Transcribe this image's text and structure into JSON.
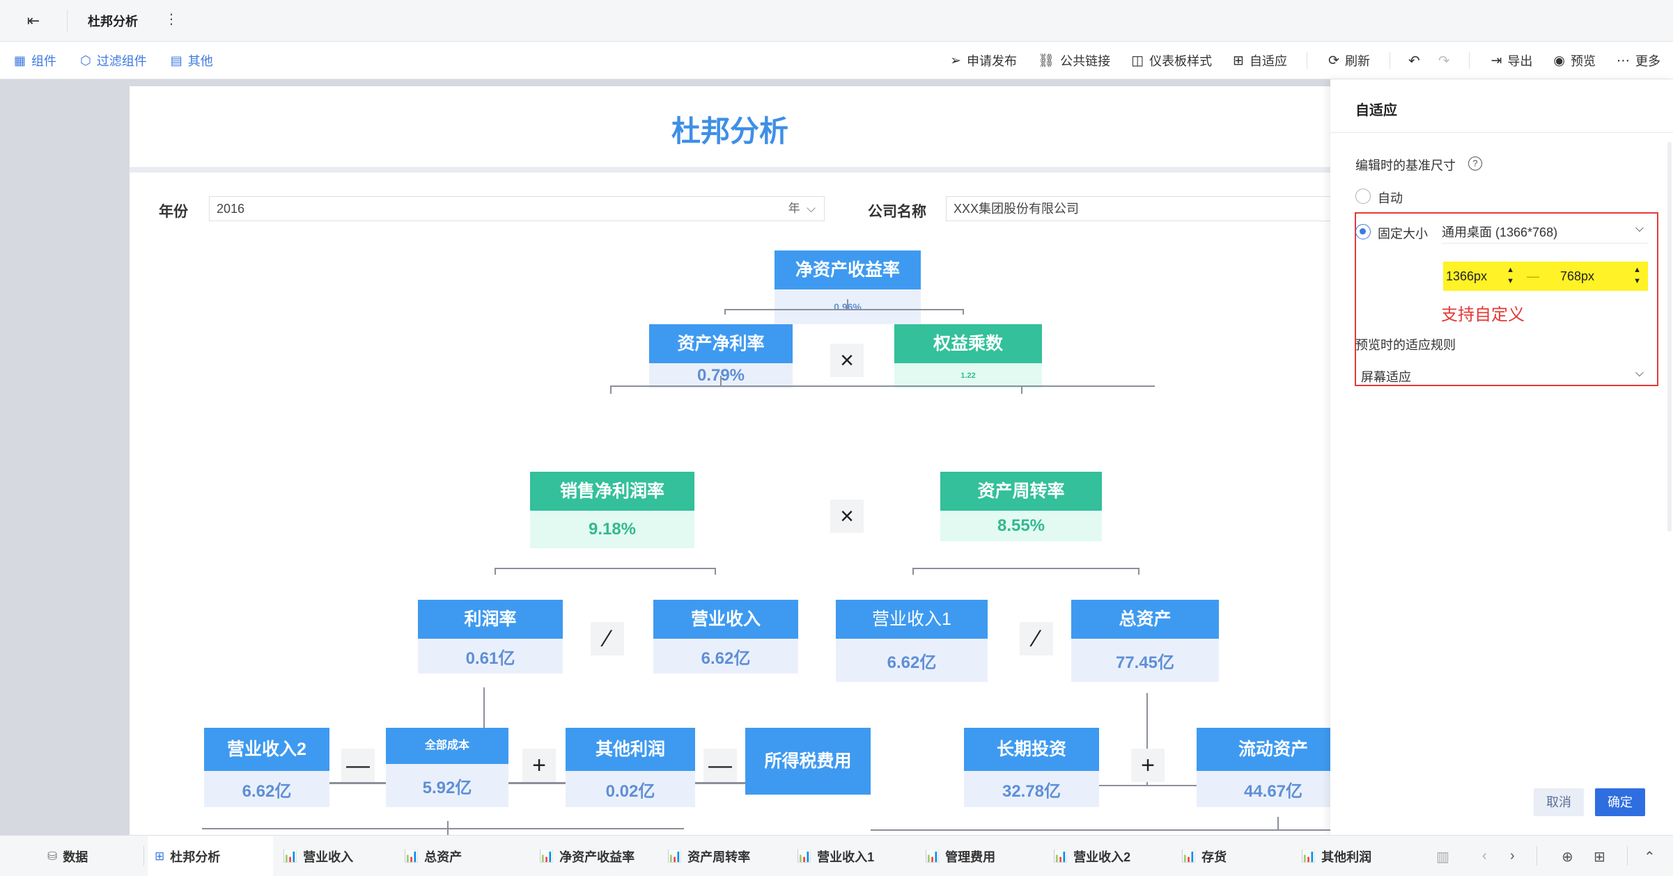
{
  "topbar": {
    "title": "杜邦分析",
    "back_icon": "exit-icon",
    "more_icon": "vertical-dots-icon"
  },
  "toolbar": {
    "left": [
      {
        "label": "组件",
        "icon": "component-icon"
      },
      {
        "label": "过滤组件",
        "icon": "filter-cube-icon"
      },
      {
        "label": "其他",
        "icon": "other-icon"
      }
    ],
    "right": [
      {
        "label": "申请发布",
        "icon": "send-icon"
      },
      {
        "label": "公共链接",
        "icon": "link-icon"
      },
      {
        "label": "仪表板样式",
        "icon": "style-icon"
      },
      {
        "label": "自适应",
        "icon": "fit-icon"
      },
      {
        "label": "刷新",
        "icon": "refresh-icon"
      },
      {
        "label": "导出",
        "icon": "export-icon"
      },
      {
        "label": "预览",
        "icon": "preview-icon"
      },
      {
        "label": "更多",
        "icon": "more-icon"
      }
    ]
  },
  "dashboard": {
    "title": "杜邦分析",
    "filters": {
      "year_label": "年份",
      "year_value": "2016",
      "year_suffix": "年",
      "company_label": "公司名称",
      "company_value": "XXX集团股份有限公司"
    },
    "metrics": {
      "roe": {
        "label": "净资产收益率",
        "value": "0.96%"
      },
      "roa": {
        "label": "资产净利率",
        "value": "0.79%"
      },
      "equity_multiplier": {
        "label": "权益乘数",
        "value": "1.22"
      },
      "net_margin": {
        "label": "销售净利润率",
        "value": "9.18%"
      },
      "asset_turnover": {
        "label": "资产周转率",
        "value": "8.55%"
      },
      "profit": {
        "label": "利润率",
        "value": "0.61亿"
      },
      "revenue": {
        "label": "营业收入",
        "value": "6.62亿"
      },
      "revenue1": {
        "label": "营业收入1",
        "value": "6.62亿"
      },
      "total_assets": {
        "label": "总资产",
        "value": "77.45亿"
      },
      "revenue2": {
        "label": "营业收入2",
        "value": "6.62亿"
      },
      "total_cost": {
        "label": "全部成本",
        "value": "5.92亿"
      },
      "other_profit": {
        "label": "其他利润",
        "value": "0.02亿"
      },
      "income_tax": {
        "label": "所得税费用",
        "value": ""
      },
      "long_term_invest": {
        "label": "长期投资",
        "value": "32.78亿"
      },
      "current_assets": {
        "label": "流动资产",
        "value": "44.67亿"
      }
    },
    "operators": {
      "multiply": "×",
      "divide": "⁄",
      "minus": "—",
      "plus": "+"
    }
  },
  "panel": {
    "title": "自适应",
    "base_size_label": "编辑时的基准尺寸",
    "help_icon": "question-circle-icon",
    "option_auto": "自动",
    "option_fixed": "固定大小",
    "fixed_preset": "通用桌面 (1366*768)",
    "width_value": "1366px",
    "height_value": "768px",
    "custom_note": "支持自定义",
    "preview_rule_label": "预览时的适应规则",
    "preview_rule_value": "屏幕适应",
    "cancel_label": "取消",
    "ok_label": "确定",
    "accent_color": "#2f6ee0",
    "highlight_color": "#e53935"
  },
  "bottom_tabs": [
    {
      "label": "数据",
      "icon": "database-icon"
    },
    {
      "label": "杜邦分析",
      "icon": "dashboard-grid-icon",
      "active": true
    },
    {
      "label": "营业收入",
      "icon": "chart-icon"
    },
    {
      "label": "总资产",
      "icon": "chart-icon"
    },
    {
      "label": "净资产收益率",
      "icon": "chart-icon"
    },
    {
      "label": "资产周转率",
      "icon": "chart-icon"
    },
    {
      "label": "营业收入1",
      "icon": "chart-icon"
    },
    {
      "label": "管理费用",
      "icon": "chart-icon"
    },
    {
      "label": "营业收入2",
      "icon": "chart-icon"
    },
    {
      "label": "存货",
      "icon": "chart-icon"
    },
    {
      "label": "其他利润",
      "icon": "chart-icon"
    }
  ]
}
